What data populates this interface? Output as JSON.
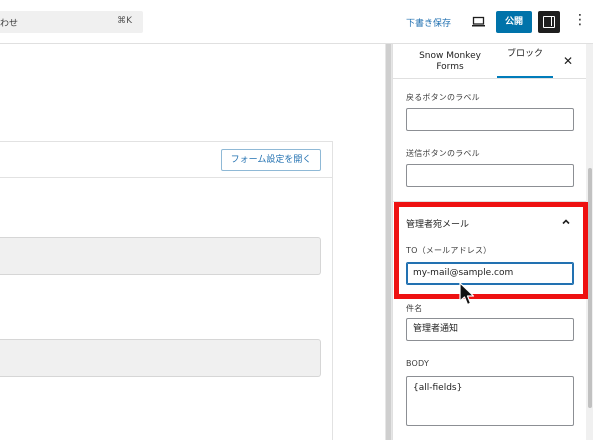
{
  "topbar": {
    "command_palette": {
      "text": "わせ",
      "shortcut": "⌘K"
    },
    "draft_label": "下書き保存",
    "publish_label": "公開"
  },
  "canvas": {
    "open_form_settings_label": "フォーム設定を開く"
  },
  "sidebar": {
    "tabs": [
      {
        "label": "Snow Monkey Forms",
        "active": false
      },
      {
        "label": "ブロック",
        "active": true
      }
    ],
    "back_button_label": {
      "label": "戻るボタンのラベル",
      "value": ""
    },
    "submit_button_label": {
      "label": "送信ボタンのラベル",
      "value": ""
    },
    "admin_mail_panel": {
      "title": "管理者宛メール",
      "to": {
        "label": "TO（メールアドレス）",
        "value": "my-mail@sample.com"
      },
      "subject": {
        "label": "件名",
        "value": "管理者通知"
      },
      "body": {
        "label": "BODY",
        "value": "{all-fields}"
      }
    }
  },
  "colors": {
    "accent": "#0073aa",
    "highlight": "#ee1111",
    "link": "#2271b1"
  },
  "icons": [
    "preview-icon",
    "settings-panel-icon",
    "more-options-icon",
    "close-icon",
    "chevron-up-icon",
    "mouse-cursor-icon"
  ]
}
